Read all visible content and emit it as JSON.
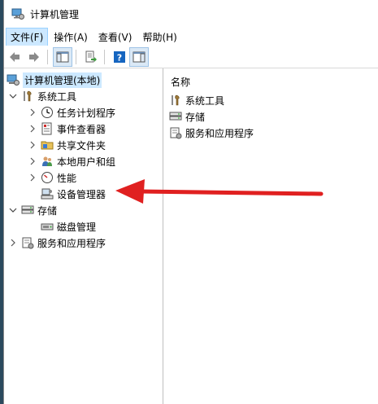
{
  "window": {
    "title": "计算机管理"
  },
  "menu": [
    "文件(F)",
    "操作(A)",
    "查看(V)",
    "帮助(H)"
  ],
  "tree": {
    "root": "计算机管理(本地)",
    "system_tools": "系统工具",
    "task_scheduler": "任务计划程序",
    "event_viewer": "事件查看器",
    "shared_folders": "共享文件夹",
    "local_users": "本地用户和组",
    "performance": "性能",
    "device_manager": "设备管理器",
    "storage": "存储",
    "disk_management": "磁盘管理",
    "services_apps": "服务和应用程序"
  },
  "list": {
    "column_name": "名称",
    "items": [
      "系统工具",
      "存储",
      "服务和应用程序"
    ]
  },
  "colors": {
    "selection": "#cce8ff",
    "annotation_arrow": "#e02020",
    "help_icon": "#1565c0"
  }
}
